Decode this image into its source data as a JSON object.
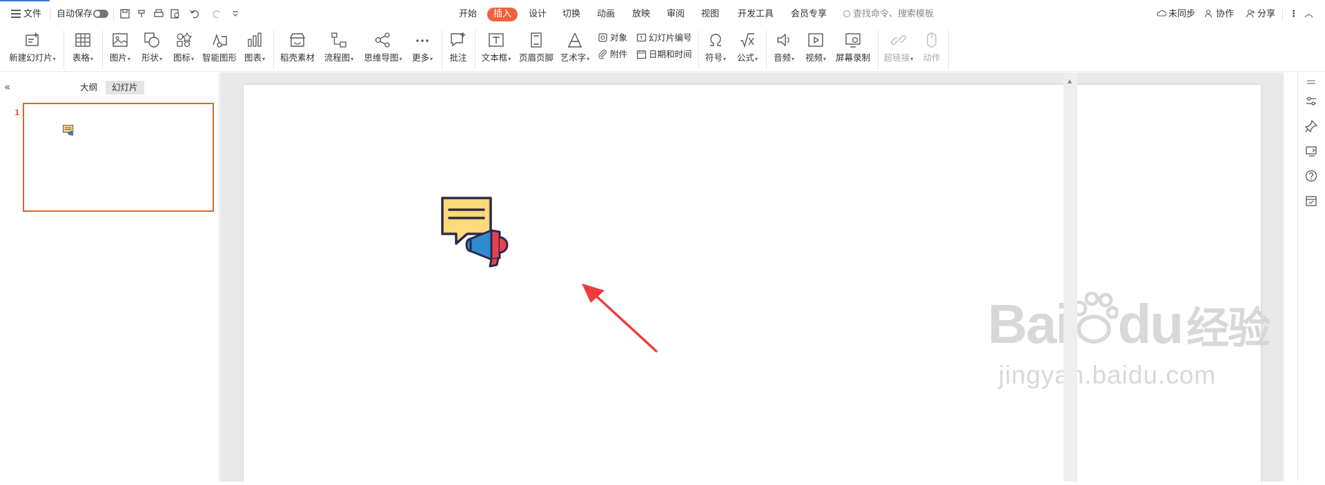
{
  "topbar": {
    "file_label": "文件",
    "autosave_label": "自动保存",
    "menu_tabs": [
      "开始",
      "插入",
      "设计",
      "切换",
      "动画",
      "放映",
      "审阅",
      "视图",
      "开发工具",
      "会员专享"
    ],
    "active_tab": "插入",
    "search_placeholder": "查找命令、搜索模板",
    "sync_label": "未同步",
    "collab_label": "协作",
    "share_label": "分享"
  },
  "ribbon": {
    "new_slide": "新建幻灯片",
    "table": "表格",
    "picture": "图片",
    "shape": "形状",
    "icon": "图标",
    "smart_graphic": "智能图形",
    "chart": "图表",
    "material": "稻壳素材",
    "flowchart": "流程图",
    "mindmap": "思维导图",
    "more": "更多",
    "comment": "批注",
    "textbox": "文本框",
    "header_footer": "页眉页脚",
    "wordart": "艺术字",
    "object": "对象",
    "attachment": "附件",
    "slide_number": "幻灯片编号",
    "date_time": "日期和时间",
    "symbol": "符号",
    "formula": "公式",
    "audio": "音频",
    "video": "视频",
    "screen_record": "屏幕录制",
    "hyperlink": "超链接",
    "action": "动作"
  },
  "leftpanel": {
    "tab_outline": "大纲",
    "tab_slides": "幻灯片",
    "slide_number": "1"
  },
  "watermark": {
    "brand": "Bai",
    "brand2": "du",
    "brand_cn": "经验",
    "url": "jingyan.baidu.com"
  },
  "colors": {
    "accent": "#f1613e",
    "selection": "#d9652b",
    "arrow": "#f03b3b",
    "bubble": "#ffd97a",
    "megaphone_blue": "#2e8bd0",
    "megaphone_red": "#e8414d"
  }
}
